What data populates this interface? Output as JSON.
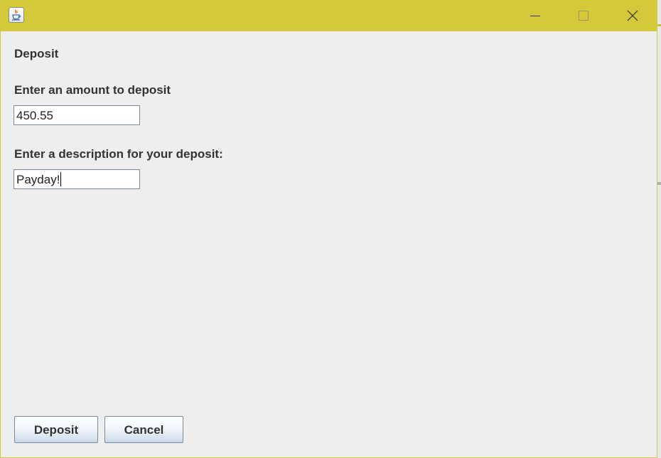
{
  "window": {
    "title": "",
    "icon": "java-cup-icon",
    "controls": [
      "minimize-icon",
      "maximize-icon",
      "close-icon"
    ],
    "titlebar_color": "#d4c93a"
  },
  "form": {
    "section_title": "Deposit",
    "amount_label": "Enter an amount to deposit",
    "amount_value": "450.55",
    "description_label": "Enter a description for your deposit:",
    "description_value": "Payday!"
  },
  "buttons": {
    "deposit_label": "Deposit",
    "cancel_label": "Cancel"
  }
}
